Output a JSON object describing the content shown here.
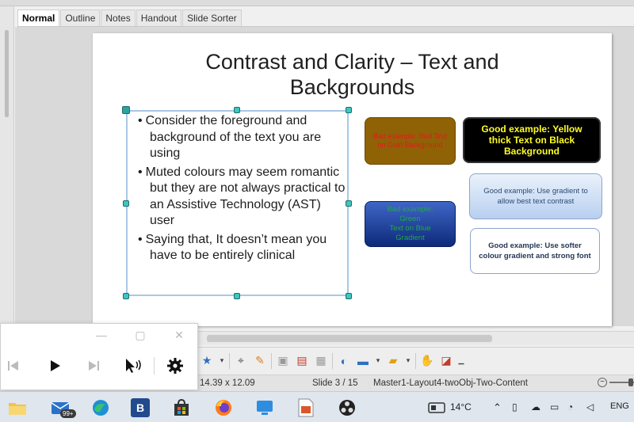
{
  "view_tabs": [
    "Normal",
    "Outline",
    "Notes",
    "Handout",
    "Slide Sorter"
  ],
  "slide": {
    "title_line1": "Contrast and Clarity – Text and",
    "title_line2": "Backgrounds",
    "bullets": [
      "Consider the foreground and background of the text you are using",
      "Muted colours may seem romantic but they are not always practical to an Assistive Technology (AST) user",
      "Saying that, It doesn’t mean you have to be entirely clinical"
    ],
    "boxes": {
      "bad_red": "Bad example: Red Text on Gold Background",
      "good_yellow": "Good example: Yellow thick Text on Black Background",
      "gradient": "Good example: Use gradient to allow best text contrast",
      "bad_green_lines": [
        "Bad example:",
        "Green",
        "Text on Blue",
        "Gradient"
      ],
      "softer": "Good example: Use softer colour gradient and strong font"
    },
    "colors": {
      "bad_red_bg": "#8f6206",
      "bad_red_text": "#e21c1c",
      "good_yellow_bg": "#000000",
      "good_yellow_text": "#ffff22",
      "bad_green_text": "#1faa46",
      "selection_handle": "#3ec6c0"
    }
  },
  "toolbar_icons": [
    "star-icon",
    "dropdown-arrow-icon",
    "points-icon",
    "pencil-icon",
    "image-icon",
    "media-icon",
    "chart-icon",
    "table-icon",
    "dropdown-arrow-icon",
    "fontwork-icon",
    "dropdown-arrow-icon",
    "shadow-icon",
    "crop-icon",
    "more-icon"
  ],
  "statusbar": {
    "size": "14.39 x 12.09",
    "slide": "Slide 3 / 15",
    "master": "Master1-Layout4-twoObj-Two-Content",
    "zoom_minus": "−"
  },
  "media_controller": {
    "window_minimize": "—",
    "window_restore": "▢",
    "window_close": "✕"
  },
  "taskbar": {
    "mail_badge": "99+",
    "app_b_label": "B",
    "weather": "14°C",
    "language": "ENG"
  }
}
